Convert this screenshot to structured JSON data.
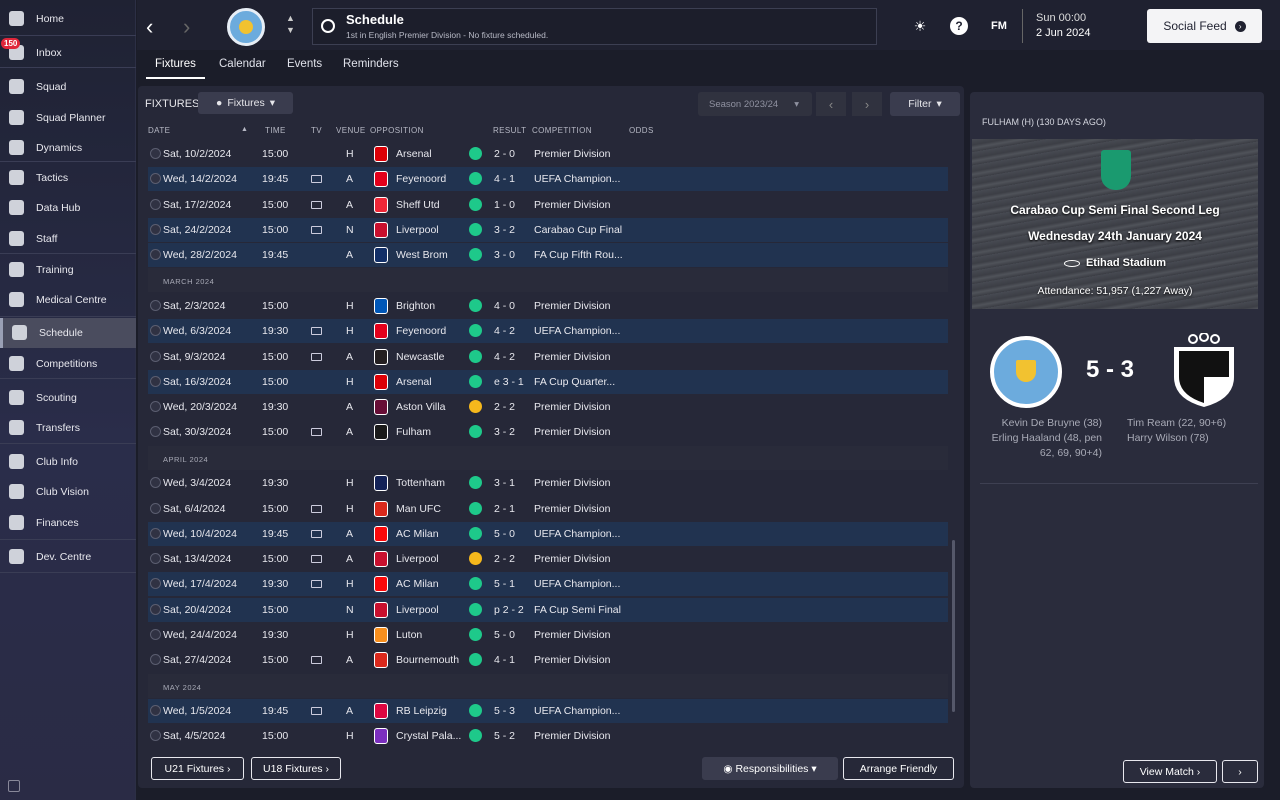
{
  "sidebar": {
    "inbox_badge": "150",
    "items": [
      {
        "label": "Home",
        "icon": "home-icon"
      },
      {
        "label": "Inbox",
        "icon": "inbox-icon"
      },
      {
        "label": "Squad",
        "icon": "shirt-icon"
      },
      {
        "label": "Squad Planner",
        "icon": "clipboard-icon"
      },
      {
        "label": "Dynamics",
        "icon": "people-icon"
      },
      {
        "label": "Tactics",
        "icon": "tactics-board-icon"
      },
      {
        "label": "Data Hub",
        "icon": "globe-icon"
      },
      {
        "label": "Staff",
        "icon": "staff-icon"
      },
      {
        "label": "Training",
        "icon": "cone-icon"
      },
      {
        "label": "Medical Centre",
        "icon": "medical-icon"
      },
      {
        "label": "Schedule",
        "icon": "calendar-icon"
      },
      {
        "label": "Competitions",
        "icon": "trophy-icon"
      },
      {
        "label": "Scouting",
        "icon": "magnifier-icon"
      },
      {
        "label": "Transfers",
        "icon": "transfer-icon"
      },
      {
        "label": "Club Info",
        "icon": "shield-icon"
      },
      {
        "label": "Club Vision",
        "icon": "briefcase-icon"
      },
      {
        "label": "Finances",
        "icon": "money-icon"
      },
      {
        "label": "Dev. Centre",
        "icon": "growth-icon"
      }
    ]
  },
  "header": {
    "title": "Schedule",
    "subtitle": "1st in English Premier Division - No fixture scheduled.",
    "fm_label": "FM",
    "time": "Sun 00:00",
    "date": "2 Jun 2024",
    "social_feed": "Social Feed"
  },
  "tabs": [
    "Fixtures",
    "Calendar",
    "Events",
    "Reminders"
  ],
  "toolbar": {
    "fixtures_label": "FIXTURES",
    "view_dropdown": "Fixtures",
    "season": "Season 2023/24",
    "filter": "Filter"
  },
  "columns": [
    "DATE",
    "TIME",
    "TV",
    "VENUE",
    "OPPOSITION",
    "RESULT",
    "COMPETITION",
    "ODDS"
  ],
  "months": [
    "MARCH 2024",
    "APRIL 2024",
    "MAY 2024"
  ],
  "fixtures": [
    {
      "date": "Sat, 10/2/2024",
      "time": "15:00",
      "tv": false,
      "venue": "H",
      "opp": "Arsenal",
      "crest": "#db0007",
      "res": "w",
      "result": "2 - 0",
      "comp": "Premier Division",
      "hl": false
    },
    {
      "date": "Wed, 14/2/2024",
      "time": "19:45",
      "tv": true,
      "venue": "A",
      "opp": "Feyenoord",
      "crest": "#e3001b",
      "res": "w",
      "result": "4 - 1",
      "comp": "UEFA Champion...",
      "hl": true
    },
    {
      "date": "Sat, 17/2/2024",
      "time": "15:00",
      "tv": true,
      "venue": "A",
      "opp": "Sheff Utd",
      "crest": "#ee2737",
      "res": "w",
      "result": "1 - 0",
      "comp": "Premier Division",
      "hl": false
    },
    {
      "date": "Sat, 24/2/2024",
      "time": "15:00",
      "tv": true,
      "venue": "N",
      "opp": "Liverpool",
      "crest": "#c8102e",
      "res": "w",
      "result": "3 - 2",
      "comp": "Carabao Cup Final",
      "hl": true
    },
    {
      "date": "Wed, 28/2/2024",
      "time": "19:45",
      "tv": false,
      "venue": "A",
      "opp": "West Brom",
      "crest": "#122f67",
      "res": "w",
      "result": "3 - 0",
      "comp": "FA Cup Fifth Rou...",
      "hl": true
    },
    {
      "date": "Sat, 2/3/2024",
      "time": "15:00",
      "tv": false,
      "venue": "H",
      "opp": "Brighton",
      "crest": "#0057b8",
      "res": "w",
      "result": "4 - 0",
      "comp": "Premier Division",
      "hl": false
    },
    {
      "date": "Wed, 6/3/2024",
      "time": "19:30",
      "tv": true,
      "venue": "H",
      "opp": "Feyenoord",
      "crest": "#e3001b",
      "res": "w",
      "result": "4 - 2",
      "comp": "UEFA Champion...",
      "hl": true
    },
    {
      "date": "Sat, 9/3/2024",
      "time": "15:00",
      "tv": true,
      "venue": "A",
      "opp": "Newcastle",
      "crest": "#241f20",
      "res": "w",
      "result": "4 - 2",
      "comp": "Premier Division",
      "hl": false
    },
    {
      "date": "Sat, 16/3/2024",
      "time": "15:00",
      "tv": false,
      "venue": "H",
      "opp": "Arsenal",
      "crest": "#db0007",
      "res": "w",
      "result": "e 3 - 1",
      "comp": "FA Cup Quarter...",
      "hl": true
    },
    {
      "date": "Wed, 20/3/2024",
      "time": "19:30",
      "tv": false,
      "venue": "A",
      "opp": "Aston Villa",
      "crest": "#670e36",
      "res": "d",
      "result": "2 - 2",
      "comp": "Premier Division",
      "hl": false
    },
    {
      "date": "Sat, 30/3/2024",
      "time": "15:00",
      "tv": true,
      "venue": "A",
      "opp": "Fulham",
      "crest": "#1a1a1a",
      "res": "w",
      "result": "3 - 2",
      "comp": "Premier Division",
      "hl": false
    },
    {
      "date": "Wed, 3/4/2024",
      "time": "19:30",
      "tv": false,
      "venue": "H",
      "opp": "Tottenham",
      "crest": "#132257",
      "res": "w",
      "result": "3 - 1",
      "comp": "Premier Division",
      "hl": false
    },
    {
      "date": "Sat, 6/4/2024",
      "time": "15:00",
      "tv": true,
      "venue": "H",
      "opp": "Man UFC",
      "crest": "#da291c",
      "res": "w",
      "result": "2 - 1",
      "comp": "Premier Division",
      "hl": false
    },
    {
      "date": "Wed, 10/4/2024",
      "time": "19:45",
      "tv": true,
      "venue": "A",
      "opp": "AC Milan",
      "crest": "#fb090b",
      "res": "w",
      "result": "5 - 0",
      "comp": "UEFA Champion...",
      "hl": true
    },
    {
      "date": "Sat, 13/4/2024",
      "time": "15:00",
      "tv": true,
      "venue": "A",
      "opp": "Liverpool",
      "crest": "#c8102e",
      "res": "d",
      "result": "2 - 2",
      "comp": "Premier Division",
      "hl": false
    },
    {
      "date": "Wed, 17/4/2024",
      "time": "19:30",
      "tv": true,
      "venue": "H",
      "opp": "AC Milan",
      "crest": "#fb090b",
      "res": "w",
      "result": "5 - 1",
      "comp": "UEFA Champion...",
      "hl": true
    },
    {
      "date": "Sat, 20/4/2024",
      "time": "15:00",
      "tv": false,
      "venue": "N",
      "opp": "Liverpool",
      "crest": "#c8102e",
      "res": "w",
      "result": "p 2 - 2",
      "comp": "FA Cup Semi Final",
      "hl": true
    },
    {
      "date": "Wed, 24/4/2024",
      "time": "19:30",
      "tv": false,
      "venue": "H",
      "opp": "Luton",
      "crest": "#f78f1e",
      "res": "w",
      "result": "5 - 0",
      "comp": "Premier Division",
      "hl": false
    },
    {
      "date": "Sat, 27/4/2024",
      "time": "15:00",
      "tv": true,
      "venue": "A",
      "opp": "Bournemouth",
      "crest": "#da291c",
      "res": "w",
      "result": "4 - 1",
      "comp": "Premier Division",
      "hl": false
    },
    {
      "date": "Wed, 1/5/2024",
      "time": "19:45",
      "tv": true,
      "venue": "A",
      "opp": "RB Leipzig",
      "crest": "#dd0741",
      "res": "w",
      "result": "5 - 3",
      "comp": "UEFA Champion...",
      "hl": true
    },
    {
      "date": "Sat, 4/5/2024",
      "time": "15:00",
      "tv": false,
      "venue": "H",
      "opp": "Crystal Pala...",
      "crest": "#7b2fbf",
      "res": "w",
      "result": "5 - 2",
      "comp": "Premier Division",
      "hl": false
    }
  ],
  "colors": {
    "win": "#1ec98a",
    "draw": "#f5b81c",
    "highlight": "#213350"
  },
  "bottom_buttons": {
    "u21": "U21 Fixtures",
    "u18": "U18 Fixtures",
    "responsibilities": "Responsibilities",
    "arrange": "Arrange Friendly"
  },
  "right_panel": {
    "title": "FULHAM (H) (130 DAYS AGO)",
    "competition": "Carabao Cup Semi Final Second Leg",
    "date": "Wednesday 24th January 2024",
    "stadium": "Etihad Stadium",
    "attendance": "Attendance: 51,957 (1,227 Away)",
    "score": "5 - 3",
    "home_scorers": [
      "Kevin De Bruyne (38)",
      "Erling Haaland (48, pen",
      "62, 69, 90+4)"
    ],
    "away_scorers": [
      "Tim Ream (22, 90+6)",
      "Harry Wilson (78)"
    ],
    "view_match": "View Match"
  }
}
